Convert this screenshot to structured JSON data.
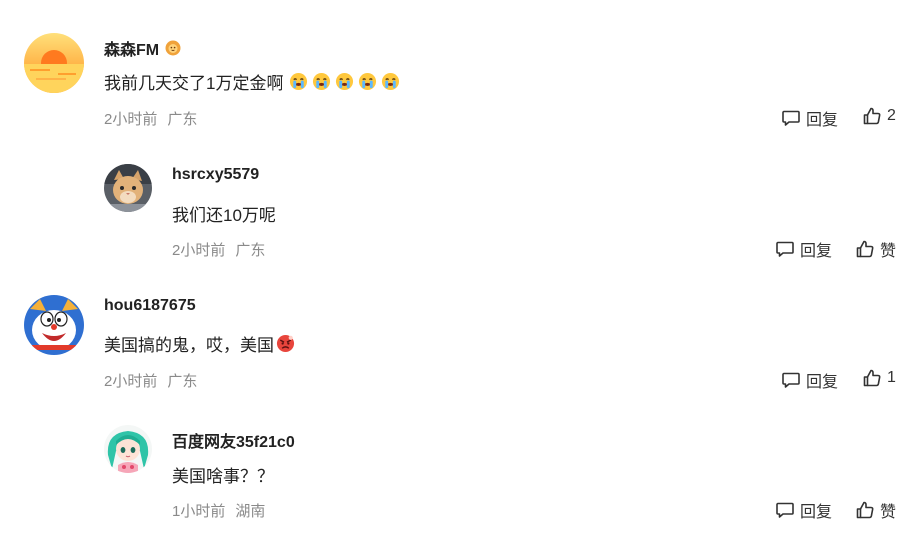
{
  "comments": [
    {
      "username": "森森FM",
      "text": "我前几天交了1万定金啊",
      "emojis": [
        "crying-face",
        "crying-face",
        "crying-face",
        "crying-face",
        "crying-face"
      ],
      "time": "2小时前",
      "location": "广东",
      "reply_label": "回复",
      "like_label": "2",
      "avatar": "sunset-avatar",
      "badge": "lion-badge-icon"
    },
    {
      "username": "hsrcxy5579",
      "text": "我们还10万呢",
      "time": "2小时前",
      "location": "广东",
      "reply_label": "回复",
      "like_label": "赞",
      "avatar": "cat-avatar"
    },
    {
      "username": "hou6187675",
      "text": "美国搞的鬼，哎，美国",
      "emojis": [
        "angry-face"
      ],
      "time": "2小时前",
      "location": "广东",
      "reply_label": "回复",
      "like_label": "1",
      "avatar": "doraemon-avatar"
    },
    {
      "username": "百度网友35f21c0",
      "text": "美国啥事？？",
      "time": "1小时前",
      "location": "湖南",
      "reply_label": "回复",
      "like_label": "赞",
      "avatar": "anime-girl-avatar"
    }
  ],
  "colors": {
    "meta_text": "#8a8a8a",
    "name_text": "#222222",
    "emoji_yellow": "#ffc83d",
    "angry_red": "#e8453c"
  }
}
